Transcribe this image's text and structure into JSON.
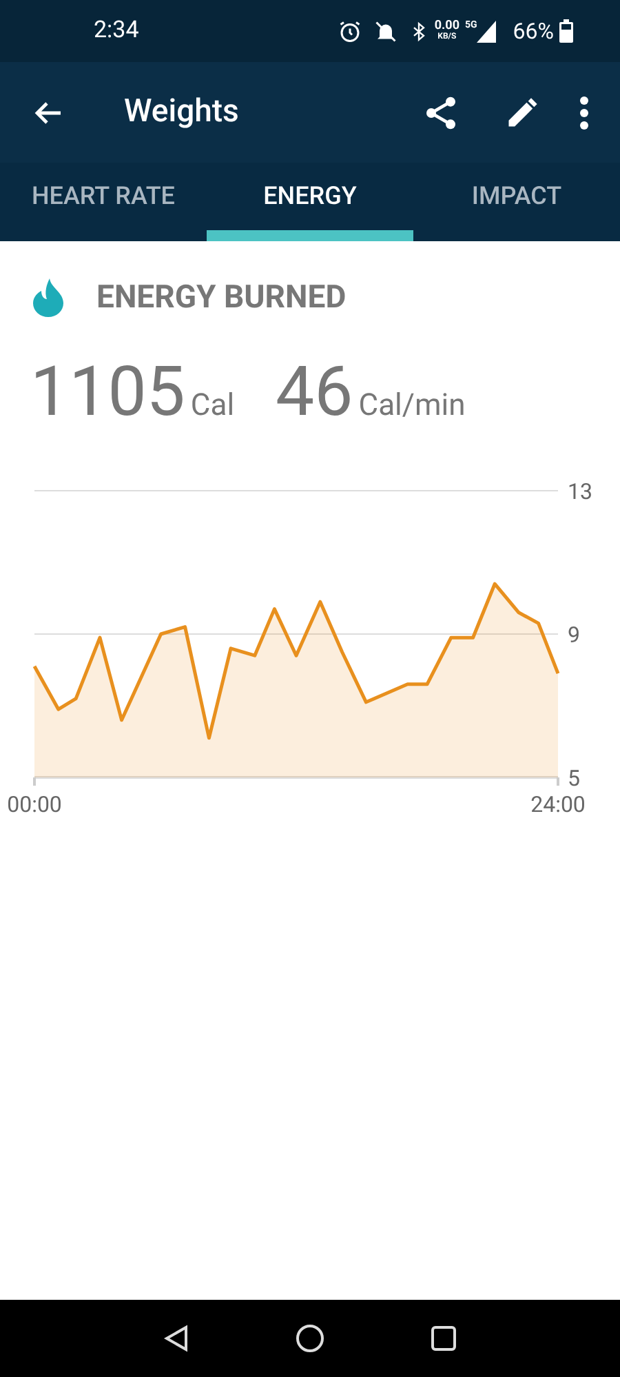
{
  "status_bar": {
    "time": "2:34",
    "net_speed": "0.00",
    "net_unit": "KB/S",
    "network": "5G",
    "battery": "66%"
  },
  "app_bar": {
    "title": "Weights"
  },
  "tabs": [
    {
      "label": "HEART RATE",
      "selected": false
    },
    {
      "label": "ENERGY",
      "selected": true
    },
    {
      "label": "IMPACT",
      "selected": false
    }
  ],
  "section": {
    "title": "ENERGY BURNED"
  },
  "stats": [
    {
      "value": "1105",
      "unit": "Cal"
    },
    {
      "value": "46",
      "unit": "Cal/min"
    }
  ],
  "chart": {
    "chart_data": {
      "type": "area",
      "x": [
        0,
        1.1,
        1.9,
        3,
        4,
        5.8,
        6.9,
        8,
        9,
        10.1,
        11,
        12,
        13.1,
        14.1,
        15.2,
        17.1,
        18,
        19.1,
        20.1,
        21.1,
        22.2,
        23.1,
        24
      ],
      "series": [
        {
          "color": "#e8901e",
          "values": [
            8.1,
            6.9,
            7.2,
            8.9,
            6.6,
            9.0,
            9.2,
            6.1,
            8.6,
            8.4,
            9.7,
            8.4,
            9.9,
            8.5,
            7.1,
            7.6,
            7.6,
            8.9,
            8.9,
            10.4,
            9.6,
            9.3,
            7.9
          ]
        }
      ],
      "xlim": [
        0,
        24
      ],
      "ylim": [
        5,
        13
      ],
      "xticks": [
        {
          "value": 0,
          "label": "00:00"
        },
        {
          "value": 24,
          "label": "24:00"
        }
      ],
      "yticks": [
        5,
        9,
        13
      ]
    }
  }
}
